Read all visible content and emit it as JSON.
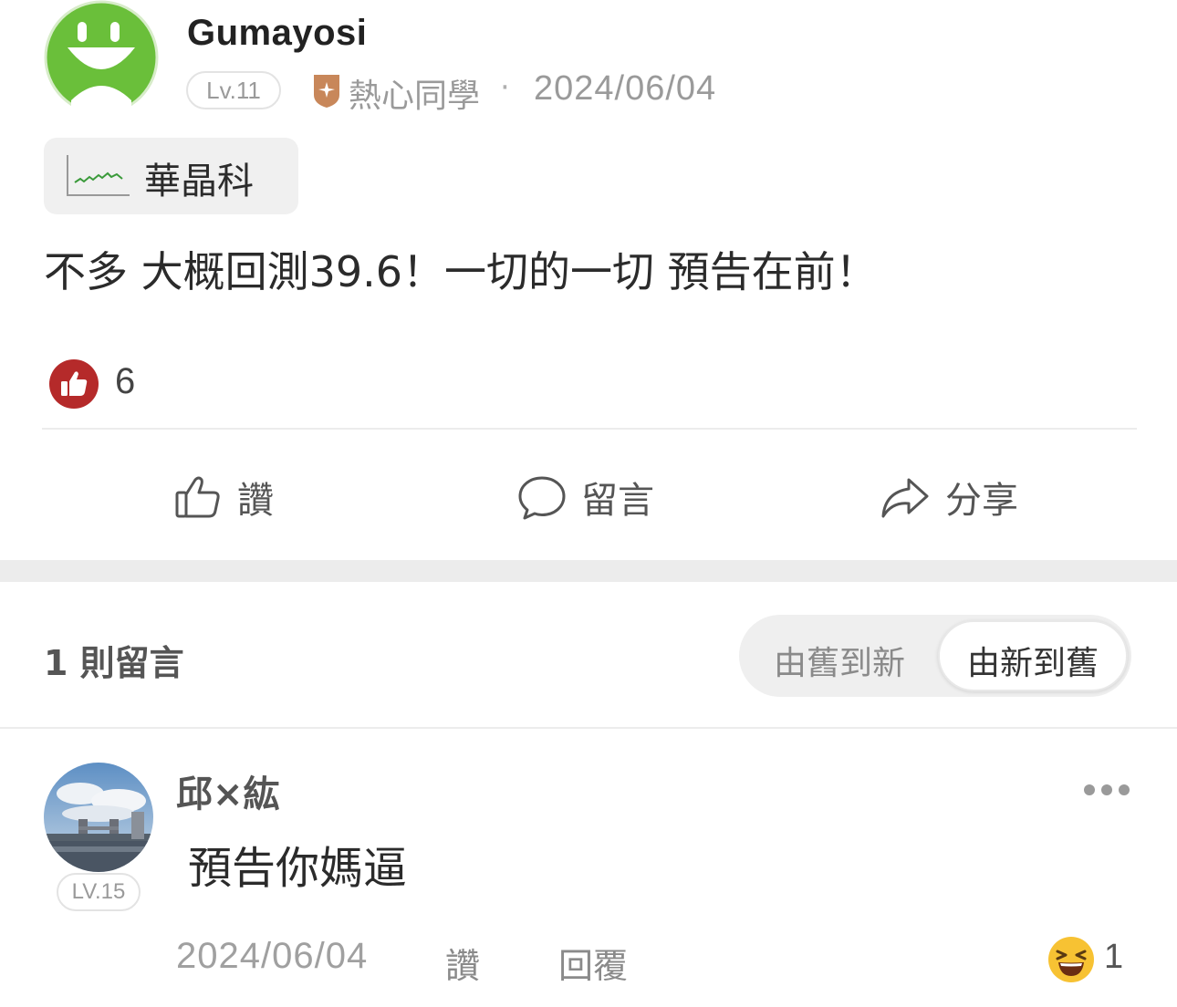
{
  "post": {
    "author": "Gumayosi",
    "level": "Lv.11",
    "badge_icon": "rank-badge-icon",
    "badge_label": "熱心同學",
    "separator": "·",
    "date": "2024/06/04",
    "stock_tag": {
      "icon": "stock-chart-icon",
      "name": "華晶科"
    },
    "content": "不多 大概回測39.6！一切的一切 預告在前！",
    "like_count": "6"
  },
  "actions": {
    "like_label": "讚",
    "comment_label": "留言",
    "share_label": "分享"
  },
  "comments_section": {
    "count_label": "1 則留言",
    "sort_options": [
      "由舊到新",
      "由新到舊"
    ],
    "selected_sort": "由新到舊"
  },
  "comment": {
    "author": "邱×紘",
    "level": "LV.15",
    "text": "預告你媽逼",
    "date": "2024/06/04",
    "like_label": "讚",
    "reply_label": "回覆",
    "reaction_icon": "laughing-emoji-icon",
    "reaction_count": "1"
  },
  "colors": {
    "avatar_green": "#6abf3a",
    "like_red": "#b52a2a",
    "badge_bronze": "#c8875a",
    "divider": "#ececec"
  }
}
